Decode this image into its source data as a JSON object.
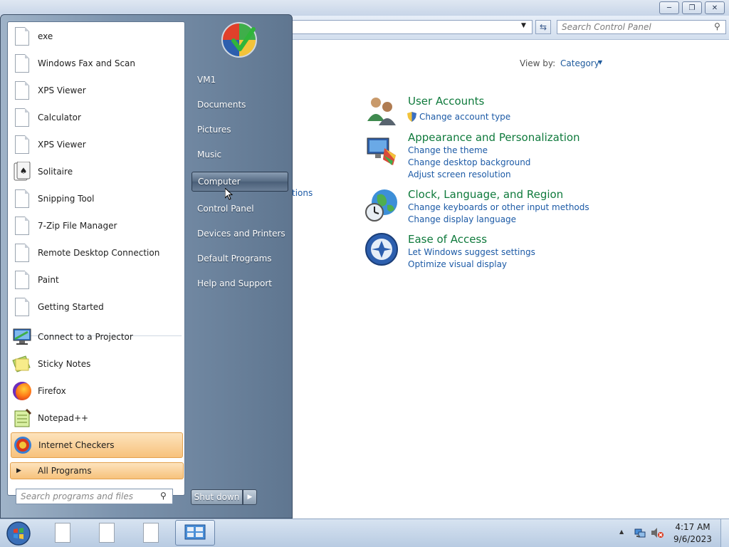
{
  "control_panel": {
    "search_placeholder": "Search Control Panel",
    "view_by_label": "View by:",
    "view_by_value": "Category",
    "partial_link": "tions",
    "categories": [
      {
        "title": "User Accounts",
        "links": [
          "Change account type"
        ]
      },
      {
        "title": "Appearance and Personalization",
        "links": [
          "Change the theme",
          "Change desktop background",
          "Adjust screen resolution"
        ]
      },
      {
        "title": "Clock, Language, and Region",
        "links": [
          "Change keyboards or other input methods",
          "Change display language"
        ]
      },
      {
        "title": "Ease of Access",
        "links": [
          "Let Windows suggest settings",
          "Optimize visual display"
        ]
      }
    ]
  },
  "start_menu": {
    "programs": [
      {
        "label": "exe",
        "icon": "blank-document-icon"
      },
      {
        "label": "Windows Fax and Scan",
        "icon": "blank-document-icon"
      },
      {
        "label": "XPS Viewer",
        "icon": "blank-document-icon"
      },
      {
        "label": "Calculator",
        "icon": "blank-document-icon"
      },
      {
        "label": "XPS Viewer",
        "icon": "blank-document-icon"
      },
      {
        "label": "Solitaire",
        "icon": "solitaire-icon"
      },
      {
        "label": "Snipping Tool",
        "icon": "blank-document-icon"
      },
      {
        "label": "7-Zip File Manager",
        "icon": "blank-document-icon"
      },
      {
        "label": "Remote Desktop Connection",
        "icon": "blank-document-icon"
      },
      {
        "label": "Paint",
        "icon": "blank-document-icon"
      },
      {
        "label": "Getting Started",
        "icon": "blank-document-icon"
      }
    ],
    "pinned": [
      {
        "label": "Connect to a Projector",
        "icon": "projector-icon"
      },
      {
        "label": "Sticky Notes",
        "icon": "sticky-notes-icon"
      },
      {
        "label": "Firefox",
        "icon": "firefox-icon"
      },
      {
        "label": "Notepad++",
        "icon": "notepadpp-icon"
      },
      {
        "label": "Internet Checkers",
        "icon": "checkers-icon"
      }
    ],
    "all_programs": "All Programs",
    "search_placeholder": "Search programs and files",
    "right_items": [
      "VM1",
      "Documents",
      "Pictures",
      "Music",
      "Computer",
      "Control Panel",
      "Devices and Printers",
      "Default Programs",
      "Help and Support"
    ],
    "shutdown_label": "Shut down"
  },
  "taskbar": {
    "time": "4:17 AM",
    "date": "9/6/2023"
  }
}
